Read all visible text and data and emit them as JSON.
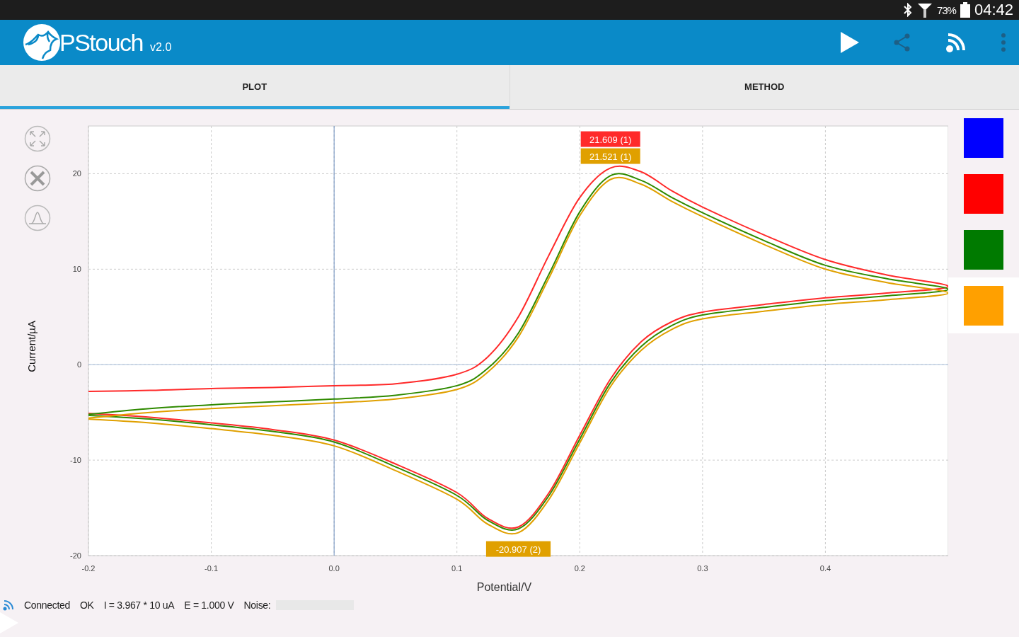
{
  "status_bar": {
    "battery": "73%",
    "time": "04:42"
  },
  "app_bar": {
    "title": "PStouch",
    "version": "v2.0"
  },
  "tabs": [
    {
      "label": "PLOT",
      "selected": true
    },
    {
      "label": "METHOD",
      "selected": false
    }
  ],
  "plot": {
    "chart_data": {
      "type": "line",
      "xlabel": "Potential/V",
      "ylabel": "Current/µA",
      "xlim": [
        -0.2,
        0.5
      ],
      "ylim": [
        -20,
        25
      ],
      "grid": true,
      "ref_lines": [
        {
          "axis": "x",
          "value": 0
        },
        {
          "axis": "y",
          "value": 0
        }
      ],
      "xticks": [
        -0.2,
        -0.1,
        {
          "value": 0,
          "label": "0.0"
        },
        0.1,
        0.2,
        0.3,
        0.4
      ],
      "yticks": [
        -20,
        -10,
        0,
        10,
        20
      ],
      "x": [
        -0.2,
        -0.15,
        -0.1,
        -0.05,
        0,
        0.05,
        0.1,
        0.125,
        0.15,
        0.175,
        0.2,
        0.225,
        0.25,
        0.275,
        0.3,
        0.35,
        0.4,
        0.45,
        0.5,
        0.45,
        0.4,
        0.35,
        0.3,
        0.275,
        0.25,
        0.225,
        0.2,
        0.175,
        0.15,
        0.125,
        0.1,
        0.05,
        0,
        -0.05,
        -0.1,
        -0.15,
        -0.2
      ],
      "series": [
        {
          "color": "#ff2a2a",
          "values": [
            -2.8,
            -2.7,
            -2.5,
            -2.4,
            -2.2,
            -2,
            -1,
            0.8,
            5,
            11.5,
            17.5,
            20.6,
            20.2,
            18.2,
            16.5,
            13.6,
            11,
            9.4,
            8.2,
            7.5,
            7,
            6.3,
            5.5,
            4.5,
            2.4,
            -1.5,
            -7.4,
            -13.4,
            -17,
            -16.1,
            -13.4,
            -10.4,
            -7.9,
            -6.8,
            -6.1,
            -5.5,
            -5.1
          ]
        },
        {
          "color": "#2f8a00",
          "values": [
            -5.2,
            -4.6,
            -4.2,
            -3.9,
            -3.6,
            -3.2,
            -2.2,
            -0.4,
            3.3,
            9.5,
            16,
            19.8,
            19.3,
            17.5,
            15.9,
            13,
            10.4,
            9,
            7.9,
            7.2,
            6.7,
            6,
            5.2,
            4.1,
            1.9,
            -1.9,
            -7.8,
            -13.7,
            -17.2,
            -16.3,
            -13.7,
            -10.7,
            -8.1,
            -7,
            -6.3,
            -5.7,
            -5.3
          ]
        },
        {
          "color": "#e0a000",
          "values": [
            -5.6,
            -5,
            -4.6,
            -4.3,
            -4,
            -3.6,
            -2.6,
            -0.8,
            2.9,
            9.1,
            15.6,
            19.4,
            18.9,
            17.1,
            15.5,
            12.6,
            10,
            8.6,
            7.5,
            6.8,
            6.3,
            5.6,
            4.8,
            3.7,
            1.5,
            -2.3,
            -8.2,
            -14.1,
            -17.6,
            -16.7,
            -14.1,
            -11.1,
            -8.5,
            -7.4,
            -6.7,
            -6.1,
            -5.7
          ]
        }
      ],
      "annotations": [
        "21.609 (1)",
        "21.521 (1)",
        "-20.907 (2)"
      ]
    }
  },
  "legend": [
    {
      "color": "#0000ff",
      "selected": false
    },
    {
      "color": "#ff0000",
      "selected": false
    },
    {
      "color": "#007a00",
      "selected": false
    },
    {
      "color": "#ffa000",
      "selected": true
    }
  ],
  "connection": {
    "status": "Connected",
    "result": "OK",
    "current": "I = 3.967 * 10 uA",
    "potential": "E = 1.000 V",
    "noise_label": "Noise:"
  }
}
